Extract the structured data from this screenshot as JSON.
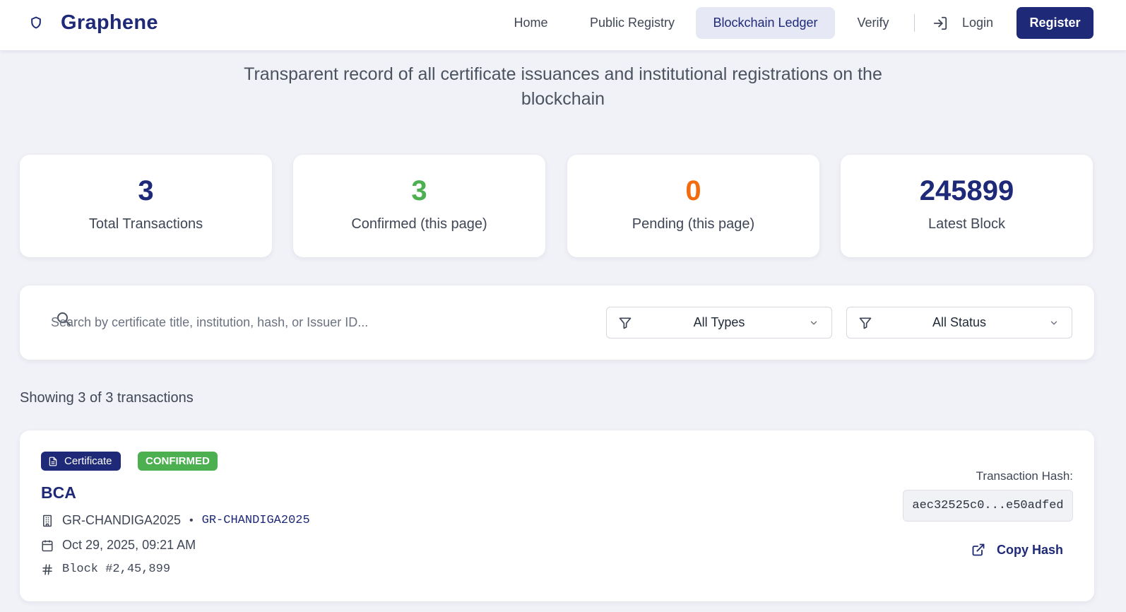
{
  "header": {
    "brand": "Graphene",
    "nav": [
      {
        "label": "Home"
      },
      {
        "label": "Public Registry"
      },
      {
        "label": "Blockchain Ledger",
        "active": true
      },
      {
        "label": "Verify"
      }
    ],
    "login_label": "Login",
    "register_label": "Register"
  },
  "subtitle": "Transparent record of all certificate issuances and institutional registrations on the blockchain",
  "stats": [
    {
      "value": "3",
      "label": "Total Transactions",
      "color": "#1e2a78"
    },
    {
      "value": "3",
      "label": "Confirmed (this page)",
      "color": "#4caf50"
    },
    {
      "value": "0",
      "label": "Pending (this page)",
      "color": "#f26b0f"
    },
    {
      "value": "245899",
      "label": "Latest Block",
      "color": "#1e2a78"
    }
  ],
  "filters": {
    "search_placeholder": "Search by certificate title, institution, hash, or Issuer ID...",
    "type_select": "All Types",
    "status_select": "All Status"
  },
  "results_count": "Showing 3 of 3 transactions",
  "transactions": [
    {
      "type_badge": "Certificate",
      "status_badge": "CONFIRMED",
      "title": "BCA",
      "institution": "GR-CHANDIGA2025",
      "issuer_id": "GR-CHANDIGA2025",
      "date": "Oct 29, 2025, 09:21 AM",
      "block": "Block #2,45,899",
      "hash_label": "Transaction Hash:",
      "hash": "aec32525c0...e50adfed",
      "copy_label": "Copy Hash"
    }
  ],
  "colors": {
    "brand": "#1e2a78",
    "confirmed": "#4caf50",
    "pending": "#f26b0f",
    "background": "#f1f2f8"
  },
  "icons": {
    "brand": "shield-icon",
    "login": "log-in-icon",
    "search": "search-icon",
    "filter": "filter-icon",
    "chevron": "chevron-down-icon",
    "certificate": "file-text-icon",
    "institution": "building-icon",
    "date": "calendar-icon",
    "block": "hash-icon",
    "copy": "external-link-icon"
  }
}
